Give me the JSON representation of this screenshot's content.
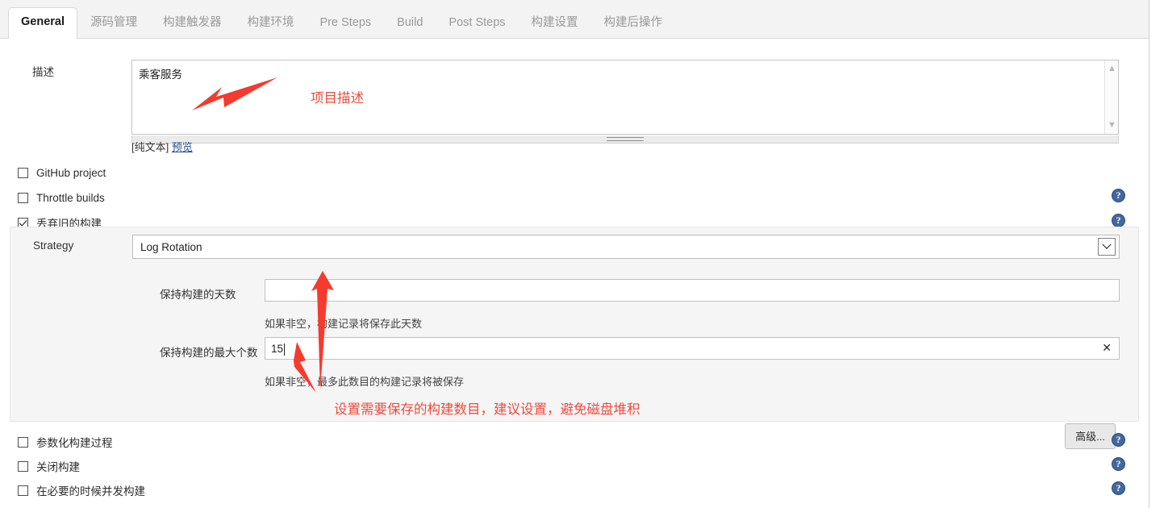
{
  "tabs": [
    {
      "label": "General",
      "active": true
    },
    {
      "label": "源码管理",
      "active": false
    },
    {
      "label": "构建触发器",
      "active": false
    },
    {
      "label": "构建环境",
      "active": false
    },
    {
      "label": "Pre Steps",
      "active": false
    },
    {
      "label": "Build",
      "active": false
    },
    {
      "label": "Post Steps",
      "active": false
    },
    {
      "label": "构建设置",
      "active": false
    },
    {
      "label": "构建后操作",
      "active": false
    }
  ],
  "description": {
    "label": "描述",
    "value": "乘客服务",
    "format_note": "[纯文本]",
    "preview_link": "预览",
    "scroll_up_icon": "chevron-up-icon",
    "scroll_down_icon": "chevron-down-icon",
    "resize_handle_icon": "resize-grip-icon"
  },
  "options": [
    {
      "label": "GitHub project",
      "checked": false,
      "help": false
    },
    {
      "label": "Throttle builds",
      "checked": false,
      "help": true
    },
    {
      "label": "丢弃旧的构建",
      "checked": true,
      "help": true
    }
  ],
  "bottom_options": [
    {
      "label": "参数化构建过程",
      "checked": false,
      "help": true
    },
    {
      "label": "关闭构建",
      "checked": false,
      "help": true
    },
    {
      "label": "在必要的时候并发构建",
      "checked": false,
      "help": true
    }
  ],
  "strategy": {
    "label": "Strategy",
    "selected": "Log Rotation",
    "dropdown_icon": "chevron-down-icon",
    "days_label": "保持构建的天数",
    "days_value": "",
    "days_hint": "如果非空，构建记录将保存此天数",
    "max_label": "保持构建的最大个数",
    "max_value": "15",
    "max_clear_icon": "clear-x-icon",
    "max_hint": "如果非空，最多此数目的构建记录将被保存",
    "advanced_button": "高级..."
  },
  "help_icon_name": "help-question-icon",
  "annotations": [
    {
      "text": "项目描述",
      "kind": "text"
    },
    {
      "text": "设置需要保存的构建数目，建议设置，避免磁盘堆积",
      "kind": "text"
    }
  ],
  "colors": {
    "annotation_red": "#ee4b3e",
    "help_blue": "#43679e",
    "link_blue": "#204a87",
    "panel_gray": "#f5f5f5",
    "tabbar_gray": "#f3f3f3"
  }
}
